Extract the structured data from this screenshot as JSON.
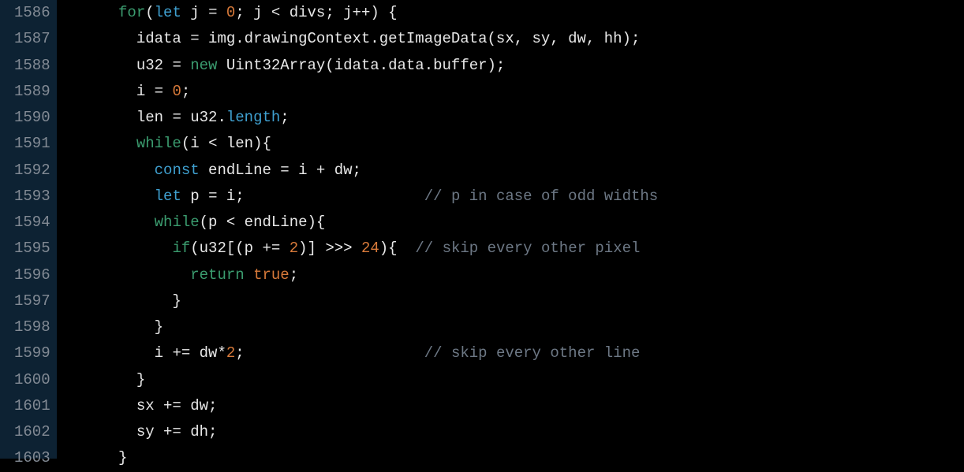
{
  "editor": {
    "startLine": 1586,
    "lines": [
      {
        "num": "1586",
        "segments": [
          {
            "t": "      ",
            "c": ""
          },
          {
            "t": "for",
            "c": "kw-flow"
          },
          {
            "t": "(",
            "c": "punct"
          },
          {
            "t": "let",
            "c": "kw-decl"
          },
          {
            "t": " j ",
            "c": "ident"
          },
          {
            "t": "=",
            "c": "op"
          },
          {
            "t": " ",
            "c": ""
          },
          {
            "t": "0",
            "c": "num"
          },
          {
            "t": "; j ",
            "c": "ident"
          },
          {
            "t": "<",
            "c": "op"
          },
          {
            "t": " divs; j",
            "c": "ident"
          },
          {
            "t": "++",
            "c": "op"
          },
          {
            "t": ") {",
            "c": "punct"
          }
        ]
      },
      {
        "num": "1587",
        "segments": [
          {
            "t": "        idata ",
            "c": "ident"
          },
          {
            "t": "=",
            "c": "op"
          },
          {
            "t": " img.drawingContext.getImageData(sx, sy, dw, hh);",
            "c": "ident"
          }
        ]
      },
      {
        "num": "1588",
        "segments": [
          {
            "t": "        u32 ",
            "c": "ident"
          },
          {
            "t": "=",
            "c": "op"
          },
          {
            "t": " ",
            "c": ""
          },
          {
            "t": "new",
            "c": "kw-flow"
          },
          {
            "t": " Uint32Array(idata.data.buffer);",
            "c": "ident"
          }
        ]
      },
      {
        "num": "1589",
        "segments": [
          {
            "t": "        i ",
            "c": "ident"
          },
          {
            "t": "=",
            "c": "op"
          },
          {
            "t": " ",
            "c": ""
          },
          {
            "t": "0",
            "c": "num"
          },
          {
            "t": ";",
            "c": "punct"
          }
        ]
      },
      {
        "num": "1590",
        "segments": [
          {
            "t": "        len ",
            "c": "ident"
          },
          {
            "t": "=",
            "c": "op"
          },
          {
            "t": " u32.",
            "c": "ident"
          },
          {
            "t": "length",
            "c": "prop"
          },
          {
            "t": ";",
            "c": "punct"
          }
        ]
      },
      {
        "num": "1591",
        "segments": [
          {
            "t": "        ",
            "c": ""
          },
          {
            "t": "while",
            "c": "kw-flow"
          },
          {
            "t": "(i ",
            "c": "ident"
          },
          {
            "t": "<",
            "c": "op"
          },
          {
            "t": " len){",
            "c": "ident"
          }
        ]
      },
      {
        "num": "1592",
        "segments": [
          {
            "t": "          ",
            "c": ""
          },
          {
            "t": "const",
            "c": "kw-decl"
          },
          {
            "t": " endLine ",
            "c": "ident"
          },
          {
            "t": "=",
            "c": "op"
          },
          {
            "t": " i ",
            "c": "ident"
          },
          {
            "t": "+",
            "c": "op"
          },
          {
            "t": " dw;",
            "c": "ident"
          }
        ]
      },
      {
        "num": "1593",
        "segments": [
          {
            "t": "          ",
            "c": ""
          },
          {
            "t": "let",
            "c": "kw-decl"
          },
          {
            "t": " p ",
            "c": "ident"
          },
          {
            "t": "=",
            "c": "op"
          },
          {
            "t": " i;                    ",
            "c": "ident"
          },
          {
            "t": "// p in case of odd widths",
            "c": "comment"
          }
        ]
      },
      {
        "num": "1594",
        "segments": [
          {
            "t": "          ",
            "c": ""
          },
          {
            "t": "while",
            "c": "kw-flow"
          },
          {
            "t": "(p ",
            "c": "ident"
          },
          {
            "t": "<",
            "c": "op"
          },
          {
            "t": " endLine){",
            "c": "ident"
          }
        ]
      },
      {
        "num": "1595",
        "segments": [
          {
            "t": "            ",
            "c": ""
          },
          {
            "t": "if",
            "c": "kw-flow"
          },
          {
            "t": "(u32[(p ",
            "c": "ident"
          },
          {
            "t": "+=",
            "c": "op"
          },
          {
            "t": " ",
            "c": ""
          },
          {
            "t": "2",
            "c": "num"
          },
          {
            "t": ")] ",
            "c": "ident"
          },
          {
            "t": ">>>",
            "c": "op"
          },
          {
            "t": " ",
            "c": ""
          },
          {
            "t": "24",
            "c": "num"
          },
          {
            "t": "){  ",
            "c": "ident"
          },
          {
            "t": "// skip every other pixel",
            "c": "comment"
          }
        ]
      },
      {
        "num": "1596",
        "segments": [
          {
            "t": "              ",
            "c": ""
          },
          {
            "t": "return",
            "c": "kw-flow"
          },
          {
            "t": " ",
            "c": ""
          },
          {
            "t": "true",
            "c": "bool"
          },
          {
            "t": ";",
            "c": "punct"
          }
        ]
      },
      {
        "num": "1597",
        "segments": [
          {
            "t": "            }",
            "c": "punct"
          }
        ]
      },
      {
        "num": "1598",
        "segments": [
          {
            "t": "          }",
            "c": "punct"
          }
        ]
      },
      {
        "num": "1599",
        "segments": [
          {
            "t": "          i ",
            "c": "ident"
          },
          {
            "t": "+=",
            "c": "op"
          },
          {
            "t": " dw",
            "c": "ident"
          },
          {
            "t": "*",
            "c": "op"
          },
          {
            "t": "2",
            "c": "num"
          },
          {
            "t": ";                    ",
            "c": "ident"
          },
          {
            "t": "// skip every other line",
            "c": "comment"
          }
        ]
      },
      {
        "num": "1600",
        "segments": [
          {
            "t": "        }",
            "c": "punct"
          }
        ]
      },
      {
        "num": "1601",
        "segments": [
          {
            "t": "        sx ",
            "c": "ident"
          },
          {
            "t": "+=",
            "c": "op"
          },
          {
            "t": " dw;",
            "c": "ident"
          }
        ]
      },
      {
        "num": "1602",
        "segments": [
          {
            "t": "        sy ",
            "c": "ident"
          },
          {
            "t": "+=",
            "c": "op"
          },
          {
            "t": " dh;",
            "c": "ident"
          }
        ]
      },
      {
        "num": "1603",
        "segments": [
          {
            "t": "      }",
            "c": "punct"
          }
        ]
      }
    ]
  }
}
